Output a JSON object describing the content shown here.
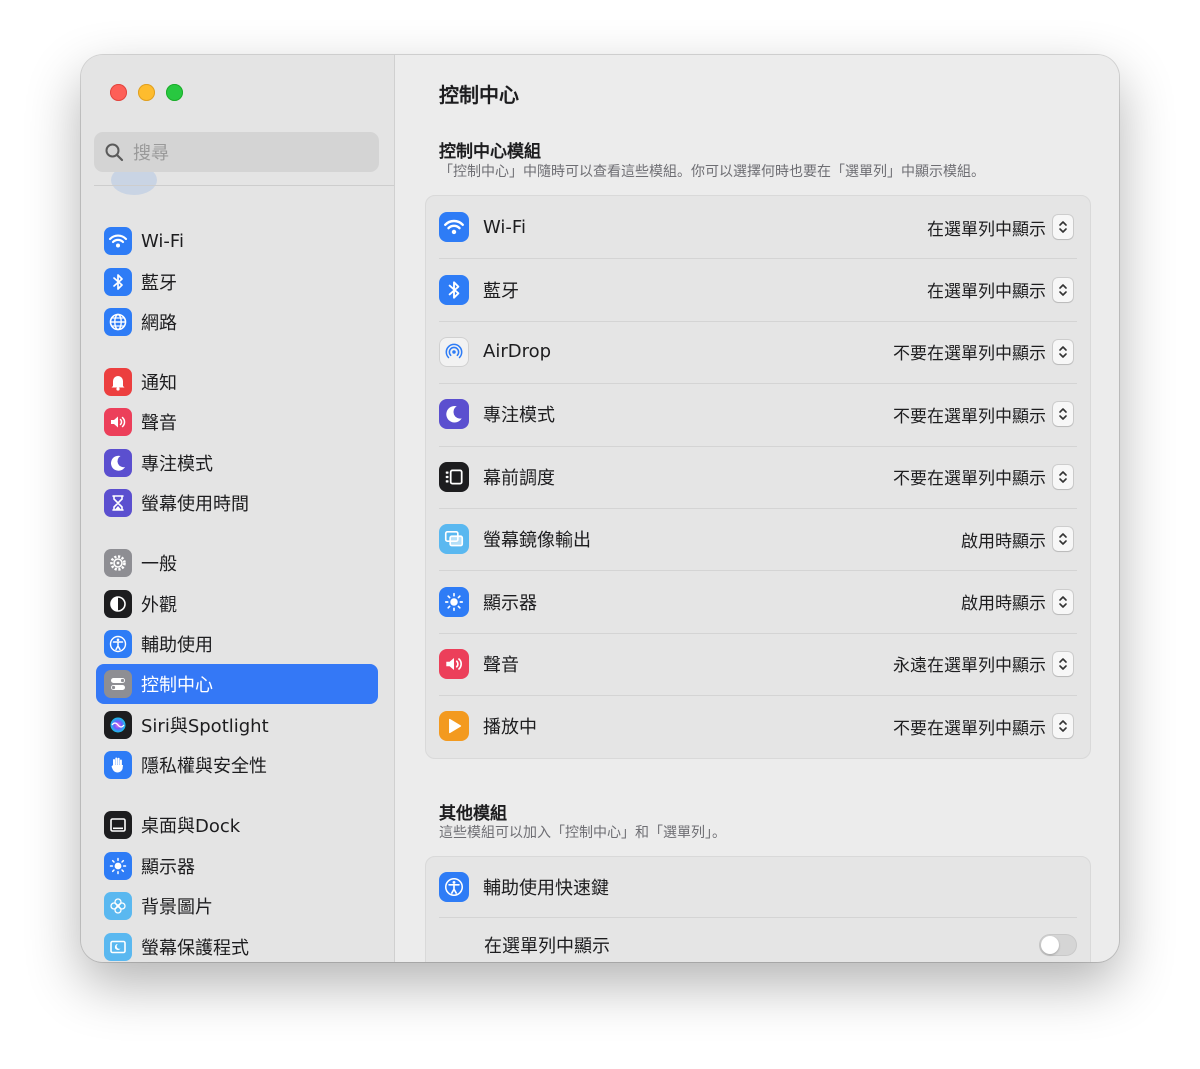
{
  "sidebar": {
    "search_placeholder": "搜尋",
    "items": [
      {
        "label": "Wi-Fi",
        "icon": "wifi-icon",
        "color": "#2e7cf6"
      },
      {
        "label": "藍牙",
        "icon": "bluetooth-icon",
        "color": "#2e7cf6"
      },
      {
        "label": "網路",
        "icon": "globe-icon",
        "color": "#2e7cf6"
      },
      {
        "label": "通知",
        "icon": "bell-icon",
        "color": "#ec3f3f"
      },
      {
        "label": "聲音",
        "icon": "speaker-icon",
        "color": "#ec3f5a"
      },
      {
        "label": "專注模式",
        "icon": "moon-icon",
        "color": "#5b4fcf"
      },
      {
        "label": "螢幕使用時間",
        "icon": "hourglass-icon",
        "color": "#5b4fcf"
      },
      {
        "label": "一般",
        "icon": "gear-icon",
        "color": "#8e8e93"
      },
      {
        "label": "外觀",
        "icon": "appearance-icon",
        "color": "#1d1d1f"
      },
      {
        "label": "輔助使用",
        "icon": "accessibility-icon",
        "color": "#2e7cf6"
      },
      {
        "label": "控制中心",
        "icon": "control-center-icon",
        "color": "#8e8e93",
        "selected": true
      },
      {
        "label": "Siri與Spotlight",
        "icon": "siri-icon",
        "color": "#1d1d1f"
      },
      {
        "label": "隱私權與安全性",
        "icon": "hand-icon",
        "color": "#2e7cf6"
      },
      {
        "label": "桌面與Dock",
        "icon": "dock-icon",
        "color": "#1d1d1f"
      },
      {
        "label": "顯示器",
        "icon": "brightness-icon",
        "color": "#2e7cf6"
      },
      {
        "label": "背景圖片",
        "icon": "wallpaper-icon",
        "color": "#5ab8f0"
      },
      {
        "label": "螢幕保護程式",
        "icon": "screensaver-icon",
        "color": "#5ab8f0"
      }
    ]
  },
  "main": {
    "title": "控制中心",
    "modules_section": {
      "title": "控制中心模組",
      "description": "「控制中心」中隨時可以查看這些模組。你可以選擇何時也要在「選單列」中顯示模組。",
      "rows": [
        {
          "label": "Wi-Fi",
          "value": "在選單列中顯示",
          "icon": "wifi-icon",
          "color": "#2e7cf6"
        },
        {
          "label": "藍牙",
          "value": "在選單列中顯示",
          "icon": "bluetooth-icon",
          "color": "#2e7cf6"
        },
        {
          "label": "AirDrop",
          "value": "不要在選單列中顯示",
          "icon": "airdrop-icon",
          "color": "#f2f2f2"
        },
        {
          "label": "專注模式",
          "value": "不要在選單列中顯示",
          "icon": "moon-icon",
          "color": "#5b4fcf"
        },
        {
          "label": "幕前調度",
          "value": "不要在選單列中顯示",
          "icon": "stage-manager-icon",
          "color": "#1d1d1f"
        },
        {
          "label": "螢幕鏡像輸出",
          "value": "啟用時顯示",
          "icon": "screen-mirroring-icon",
          "color": "#5ab8f0"
        },
        {
          "label": "顯示器",
          "value": "啟用時顯示",
          "icon": "brightness-icon",
          "color": "#2e7cf6"
        },
        {
          "label": "聲音",
          "value": "永遠在選單列中顯示",
          "icon": "speaker-icon",
          "color": "#ec3f5a"
        },
        {
          "label": "播放中",
          "value": "不要在選單列中顯示",
          "icon": "play-icon",
          "color": "#f39a1f"
        }
      ]
    },
    "other_section": {
      "title": "其他模組",
      "description": "這些模組可以加入「控制中心」和「選單列」。",
      "module_label": "輔助使用快速鍵",
      "module_icon": "accessibility-icon",
      "toggle_label": "在選單列中顯示",
      "toggle_on": false
    }
  }
}
